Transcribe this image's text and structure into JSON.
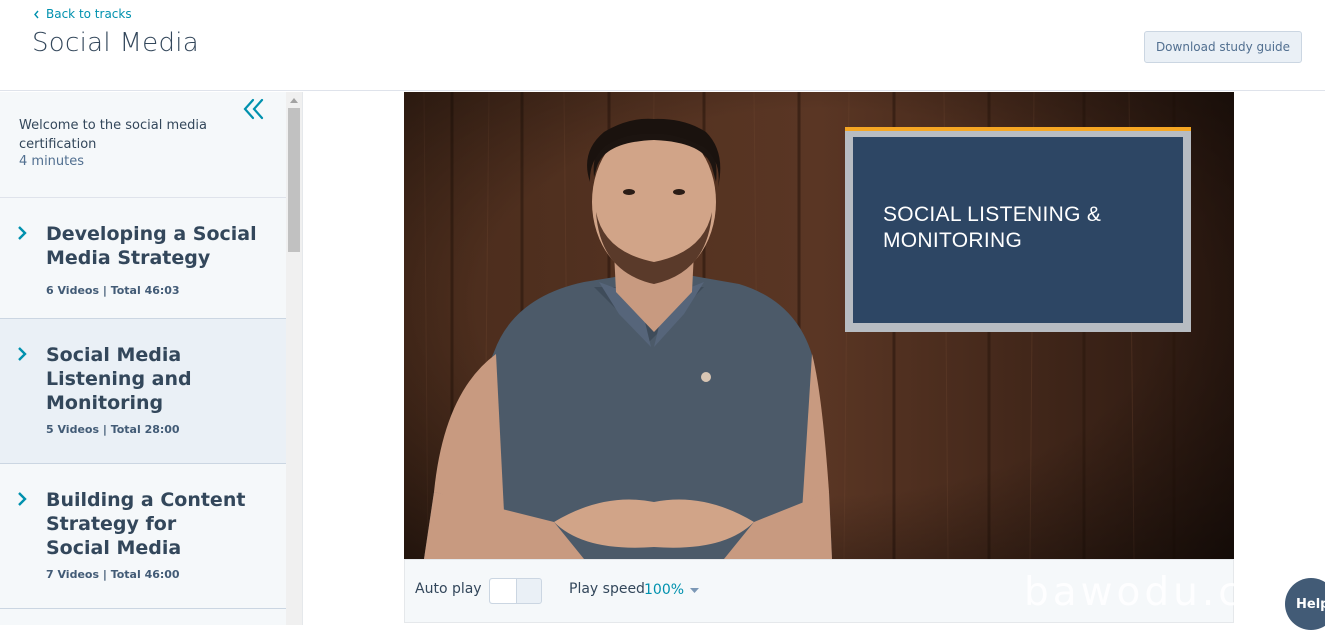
{
  "header": {
    "back_label": "Back to tracks",
    "title": "Social Media",
    "download_label": "Download study guide"
  },
  "sidebar": {
    "intro": {
      "title": "Welcome to the social media certification",
      "duration": "4 minutes"
    },
    "sections": [
      {
        "title": "Developing a Social Media Strategy",
        "meta": "6 Videos | Total 46:03",
        "active": false
      },
      {
        "title": "Social Media Listening and Monitoring",
        "meta": "5 Videos | Total 28:00",
        "active": true
      },
      {
        "title": "Building a Content Strategy for Social Media",
        "meta": "7 Videos | Total 46:00",
        "active": false
      }
    ]
  },
  "video": {
    "slide_line1": "SOCIAL LISTENING &",
    "slide_line2": "MONITORING"
  },
  "controls": {
    "autoplay_label": "Auto play",
    "autoplay_on": false,
    "speed_label": "Play speed",
    "speed_value": "100%"
  },
  "help_label": "Help",
  "watermark": "bawodu.com",
  "colors": {
    "accent": "#0091ae",
    "text": "#33475b",
    "sidebar_bg": "#f5f8fa",
    "slide_bg": "#2d4664",
    "slide_accent": "#f5a623"
  }
}
